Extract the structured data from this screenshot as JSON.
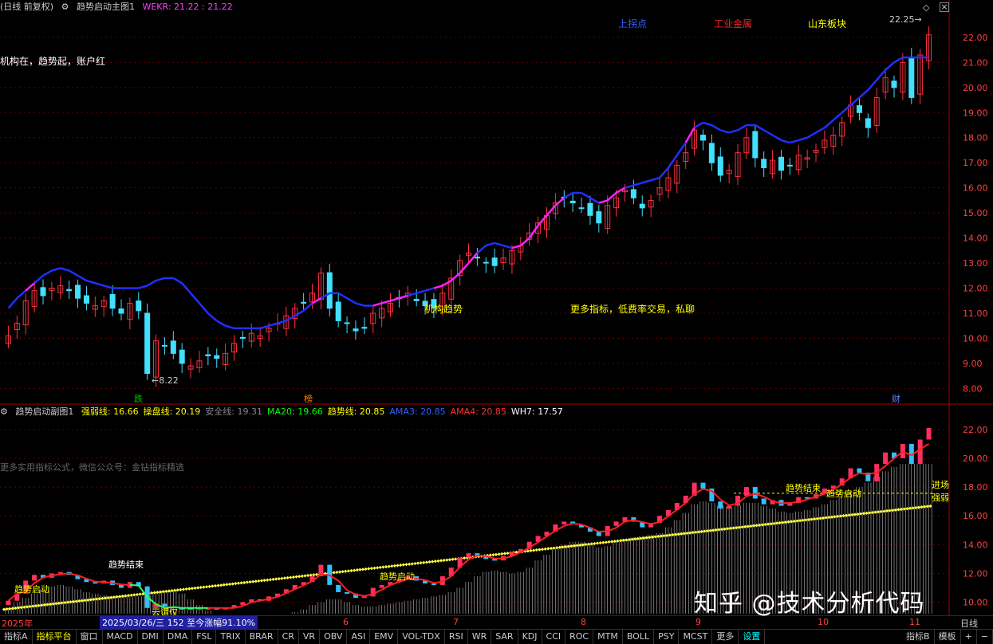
{
  "main_header": {
    "window_title": "(日线 前复权)",
    "indicator_name": "趋势启动主图1",
    "wekr_label": "WEKR: 21.22 : 21.22"
  },
  "main_annotations": {
    "top_left_slogan": "机构在，趋势起，账户红",
    "signal_upper_turn": "上拐点",
    "signal_industry": "工业金属",
    "signal_region": "山东板块",
    "label_inst_trend": "机构趋势",
    "label_more_indicators": "更多指标，低费率交易，私聊",
    "low_price": "8.22",
    "high_price": "22.25",
    "marker_drop": "跌",
    "marker_rank": "榜",
    "marker_fin": "财"
  },
  "main_axis": [
    "22.00",
    "21.00",
    "20.00",
    "19.00",
    "18.00",
    "17.00",
    "16.00",
    "15.00",
    "14.00",
    "13.00",
    "12.00",
    "11.00",
    "10.00",
    "9.00",
    "8.00"
  ],
  "sub_header": {
    "indicator_name": "趋势启动副图1",
    "items": [
      {
        "label": "强弱线: 16.66",
        "color": "#ffff00"
      },
      {
        "label": "操盘线: 20.19",
        "color": "#ffff00"
      },
      {
        "label": "安全线: 19.31",
        "color": "#888888"
      },
      {
        "label": "MA20: 19.66",
        "color": "#00ff00"
      },
      {
        "label": "趋势线: 20.85",
        "color": "#ffff00"
      },
      {
        "label": "AMA3: 20.85",
        "color": "#3060ff"
      },
      {
        "label": "AMA4: 20.85",
        "color": "#ff3030"
      },
      {
        "label": "WH7: 17.57",
        "color": "#ffffff"
      }
    ]
  },
  "sub_annotations": {
    "formula_note": "更多实用指标公式，微信公众号：金钻指标精选",
    "trend_end_1": "趋势结束",
    "trend_start_1": "趋势启动",
    "cloud_box": "云谓仅",
    "trend_start_2": "趋势启动",
    "trend_end_2": "趋势结束",
    "trend_start_3": "趋势启动",
    "entry": "进场",
    "strong_weak": "强弱"
  },
  "sub_axis": [
    "22.00",
    "20.00",
    "18.00",
    "16.00",
    "14.00",
    "12.00",
    "10.00"
  ],
  "timebar": {
    "year": "2025年",
    "range_info": "2025/03/26/三 152 至今涨幅91.10%",
    "months": [
      "6",
      "7",
      "8",
      "9",
      "10",
      "11"
    ],
    "period": "日线"
  },
  "bottom_tabs": [
    "指标A",
    "指标平台",
    "窗口",
    "MACD",
    "DMI",
    "DMA",
    "FSL",
    "TRIX",
    "BRAR",
    "CR",
    "VR",
    "OBV",
    "ASI",
    "EMV",
    "VOL-TDX",
    "RSI",
    "WR",
    "SAR",
    "KDJ",
    "CCI",
    "ROC",
    "MTM",
    "BOLL",
    "PSY",
    "MCST",
    "更多",
    "设置"
  ],
  "bottom_right_tabs": [
    "指标B",
    "模板",
    "+",
    "−"
  ],
  "watermark": "知乎 @技术分析代码",
  "colors": {
    "up": "#ff3040",
    "down": "#40e0ff",
    "ma_blue": "#2030ff",
    "ma_magenta": "#ff20ff",
    "yellow": "#ffff00",
    "grid": "#800000"
  },
  "chart_data": {
    "type": "candlestick",
    "title": "",
    "ylim": [
      7.6,
      22.6
    ],
    "closes": [
      10.1,
      10.6,
      11.5,
      11.9,
      11.7,
      12.0,
      12.1,
      11.9,
      11.6,
      11.4,
      11.3,
      11.5,
      11.2,
      11.0,
      11.4,
      11.1,
      8.6,
      9.9,
      9.7,
      9.4,
      9.0,
      8.9,
      9.1,
      9.3,
      9.2,
      9.4,
      9.8,
      10.0,
      10.2,
      10.1,
      10.4,
      10.6,
      10.9,
      11.2,
      11.4,
      11.8,
      12.6,
      11.2,
      10.7,
      10.6,
      10.3,
      10.4,
      11.0,
      11.2,
      11.4,
      11.6,
      11.8,
      11.5,
      11.3,
      11.2,
      11.8,
      12.4,
      13.1,
      13.4,
      13.2,
      13.0,
      12.9,
      13.2,
      13.5,
      13.7,
      14.2,
      14.6,
      14.9,
      15.4,
      15.6,
      15.4,
      15.2,
      14.9,
      14.6,
      15.3,
      15.6,
      15.9,
      15.6,
      15.2,
      15.5,
      16.0,
      16.4,
      16.9,
      17.4,
      18.3,
      17.9,
      17.0,
      16.5,
      16.7,
      17.4,
      18.0,
      17.2,
      16.8,
      17.1,
      16.7,
      16.9,
      17.3,
      17.2,
      17.5,
      17.9,
      18.1,
      18.6,
      19.3,
      19.0,
      18.4,
      19.6,
      20.4,
      20.0,
      21.0,
      19.6,
      21.3,
      22.1
    ],
    "ma_line": [
      11.2,
      11.6,
      11.9,
      12.2,
      12.5,
      12.7,
      12.8,
      12.7,
      12.5,
      12.3,
      12.2,
      12.1,
      12.0,
      12.0,
      12.0,
      12.0,
      12.1,
      12.3,
      12.4,
      12.4,
      12.2,
      11.8,
      11.4,
      11.0,
      10.7,
      10.5,
      10.4,
      10.4,
      10.4,
      10.4,
      10.5,
      10.6,
      10.7,
      10.9,
      11.1,
      11.4,
      11.6,
      11.8,
      11.8,
      11.6,
      11.4,
      11.3,
      11.3,
      11.4,
      11.5,
      11.6,
      11.7,
      11.8,
      11.9,
      12.0,
      12.1,
      12.3,
      12.6,
      13.0,
      13.4,
      13.7,
      13.8,
      13.7,
      13.6,
      13.7,
      14.0,
      14.5,
      14.9,
      15.3,
      15.6,
      15.8,
      15.8,
      15.6,
      15.4,
      15.5,
      15.8,
      16.0,
      16.1,
      16.2,
      16.3,
      16.4,
      16.8,
      17.3,
      17.8,
      18.4,
      18.6,
      18.5,
      18.3,
      18.2,
      18.3,
      18.5,
      18.5,
      18.3,
      18.1,
      17.9,
      17.8,
      17.9,
      18.0,
      18.2,
      18.4,
      18.7,
      19.0,
      19.3,
      19.6,
      19.9,
      20.3,
      20.7,
      21.0,
      21.2,
      21.2,
      21.2,
      21.2
    ]
  }
}
